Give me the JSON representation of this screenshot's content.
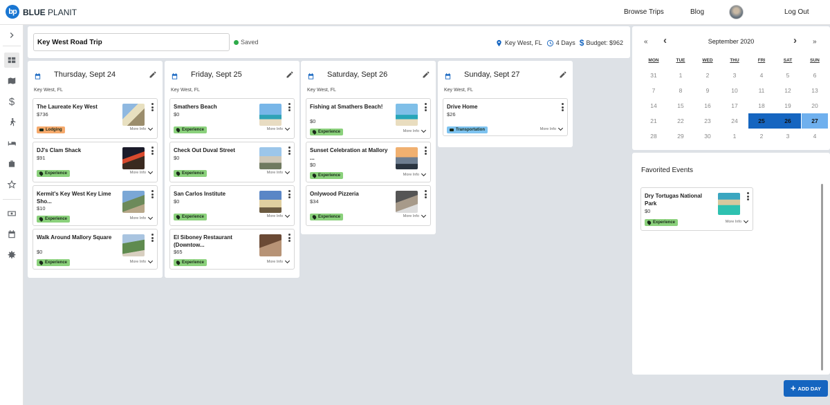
{
  "app": {
    "brand_bold": "BLUE",
    "brand_rest": "PLANIT",
    "logo_text": "bp"
  },
  "nav": {
    "browse_trips": "Browse Trips",
    "blog": "Blog",
    "log_out": "Log Out"
  },
  "trip": {
    "title": "Key West Road Trip",
    "saved_label": "Saved",
    "location": "Key West, FL",
    "duration": "4 Days",
    "budget": "Budget: $962"
  },
  "days": [
    {
      "title": "Thursday, Sept 24",
      "location": "Key West, FL",
      "events": [
        {
          "name": "The Laureate Key West",
          "price": "$736",
          "tag": "Lodging",
          "tag_kind": "lodging",
          "more": "More Info"
        },
        {
          "name": "DJ's Clam Shack",
          "price": "$91",
          "tag": "Experience",
          "tag_kind": "experience",
          "more": "More Info"
        },
        {
          "name": "Kermit's Key West Key Lime Sho...",
          "price": "$10",
          "tag": "Experience",
          "tag_kind": "experience",
          "more": "More Info"
        },
        {
          "name": "Walk Around Mallory Square",
          "price": "$0",
          "tag": "Experience",
          "tag_kind": "experience",
          "more": "More Info"
        }
      ]
    },
    {
      "title": "Friday, Sept 25",
      "location": "Key West, FL",
      "events": [
        {
          "name": "Smathers Beach",
          "price": "$0",
          "tag": "Experience",
          "tag_kind": "experience",
          "more": "More Info"
        },
        {
          "name": "Check Out Duval Street",
          "price": "$0",
          "tag": "Experience",
          "tag_kind": "experience",
          "more": "More Info"
        },
        {
          "name": "San Carlos Institute",
          "price": "$0",
          "tag": "Experience",
          "tag_kind": "experience",
          "more": "More Info"
        },
        {
          "name": "El Siboney Restaurant (Downtow...",
          "price": "$65",
          "tag": "Experience",
          "tag_kind": "experience",
          "more": "More Info"
        }
      ]
    },
    {
      "title": "Saturday, Sept 26",
      "location": "Key West, FL",
      "events": [
        {
          "name": "Fishing at Smathers Beach!",
          "price": "$0",
          "tag": "Experience",
          "tag_kind": "experience",
          "more": "More Info"
        },
        {
          "name": "Sunset Celebration at Mallory ...",
          "price": "$0",
          "tag": "Experience",
          "tag_kind": "experience",
          "more": "More Info"
        },
        {
          "name": "Onlywood Pizzeria",
          "price": "$34",
          "tag": "Experience",
          "tag_kind": "experience",
          "more": "More Info"
        }
      ]
    },
    {
      "title": "Sunday, Sept 27",
      "location": "Key West, FL",
      "events": [
        {
          "name": "Drive Home",
          "price": "$26",
          "tag": "Transportation",
          "tag_kind": "transportation",
          "more": "More Info"
        }
      ]
    }
  ],
  "calendar": {
    "month": "September 2020",
    "nav_prev_year": "«",
    "nav_prev": "‹",
    "nav_next": "›",
    "nav_next_year": "»",
    "weekdays": [
      "MON",
      "TUE",
      "WED",
      "THU",
      "FRI",
      "SAT",
      "SUN"
    ],
    "weeks": [
      [
        "31",
        "1",
        "2",
        "3",
        "4",
        "5",
        "6"
      ],
      [
        "7",
        "8",
        "9",
        "10",
        "11",
        "12",
        "13"
      ],
      [
        "14",
        "15",
        "16",
        "17",
        "18",
        "19",
        "20"
      ],
      [
        "21",
        "22",
        "23",
        "24",
        "25",
        "26",
        "27"
      ],
      [
        "28",
        "29",
        "30",
        "1",
        "2",
        "3",
        "4"
      ]
    ],
    "selected_days": [
      "25",
      "26"
    ],
    "selected_end_day": "27",
    "selected_color": "#1565c0",
    "selected_end_color": "#6fb0ee"
  },
  "favorites": {
    "title": "Favorited Events",
    "items": [
      {
        "name": "Dry Tortugas National Park",
        "price": "$0",
        "tag": "Experience",
        "tag_kind": "experience",
        "more": "More Info"
      }
    ]
  },
  "actions": {
    "add_day": "ADD DAY"
  },
  "colors": {
    "accent": "#1565c0",
    "experience_tag": "#8bd17c",
    "lodging_tag": "#f5a96b",
    "transportation_tag": "#7ec3f0",
    "background": "#dde1e6"
  }
}
